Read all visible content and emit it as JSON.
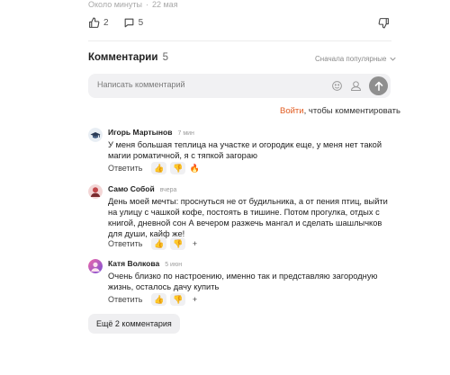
{
  "post": {
    "meta_time": "Около минуты",
    "meta_date": "22 мая",
    "likes": "2",
    "comments_count": "5"
  },
  "comments_header": {
    "title": "Комментарии",
    "count": "5",
    "sort_label": "Сначала популярные"
  },
  "composer": {
    "placeholder": "Написать комментарий"
  },
  "login": {
    "link": "Войти",
    "rest": ", чтобы комментировать"
  },
  "comments": [
    {
      "author": "Игорь Мартынов",
      "time": "7 мин",
      "text": "У меня большая теплица на участке и огородик еще, у меня нет такой магии роматичной, я с тяпкой загораю",
      "reply_label": "Ответить",
      "reactions": [
        "👍",
        "👎",
        "🔥"
      ]
    },
    {
      "author": "Само Собой",
      "time": "вчера",
      "text": "День моей мечты: проснуться не от будильника, а от пения птиц, выйти на улицу с чашкой кофе, постоять в тишине. Потом прогулка, отдых с книгой, дневной сон А вечером разжечь мангал и сделать шашлычков для души, кайф же!",
      "reply_label": "Ответить",
      "reactions": [
        "👍",
        "👎",
        "+"
      ]
    },
    {
      "author": "Катя Волкова",
      "time": "5 июн",
      "text": "Очень близко по настроению, именно так и представляю загородную жизнь, осталось дачу купить",
      "reply_label": "Ответить",
      "reactions": [
        "👍",
        "👎",
        "+"
      ]
    }
  ],
  "more_button": "Ещё 2 комментария",
  "icons": {
    "like": "thumbs-up-icon",
    "comment": "speech-bubble-icon",
    "dislike": "thumbs-down-icon",
    "emoji": "smiley-icon",
    "sticker": "sticker-icon",
    "send": "arrow-up-icon",
    "sort": "chevron-down-icon"
  }
}
